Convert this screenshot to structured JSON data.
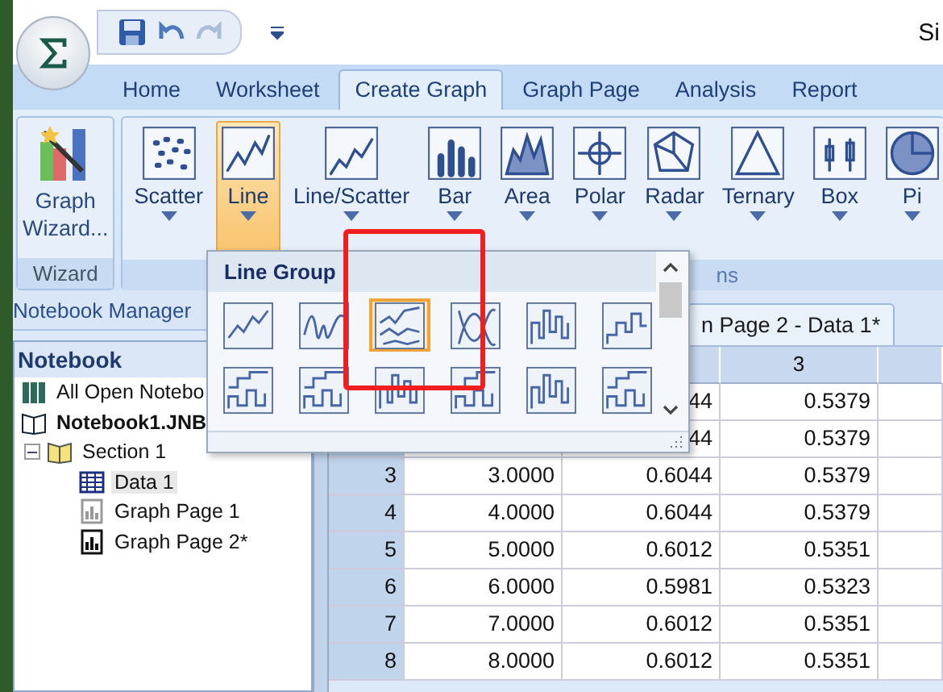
{
  "window": {
    "title": "Si"
  },
  "tabs": [
    {
      "label": "Home",
      "selected": false
    },
    {
      "label": "Worksheet",
      "selected": false
    },
    {
      "label": "Create Graph",
      "selected": true
    },
    {
      "label": "Graph Page",
      "selected": false
    },
    {
      "label": "Analysis",
      "selected": false
    },
    {
      "label": "Report",
      "selected": false
    }
  ],
  "ribbon": {
    "wizard": {
      "label": "Graph Wizard...",
      "group_label": "Wizard"
    },
    "buttons": [
      {
        "kind": "scatter",
        "label": "Scatter",
        "selected": false
      },
      {
        "kind": "line",
        "label": "Line",
        "selected": true
      },
      {
        "kind": "linescatter",
        "label": "Line/Scatter",
        "selected": false
      },
      {
        "kind": "bar",
        "label": "Bar",
        "selected": false
      },
      {
        "kind": "area",
        "label": "Area",
        "selected": false
      },
      {
        "kind": "polar",
        "label": "Polar",
        "selected": false
      },
      {
        "kind": "radar",
        "label": "Radar",
        "selected": false
      },
      {
        "kind": "ternary",
        "label": "Ternary",
        "selected": false
      },
      {
        "kind": "box",
        "label": "Box",
        "selected": false
      },
      {
        "kind": "pie",
        "label": "Pi",
        "selected": false
      }
    ],
    "group_label": "ns"
  },
  "gallery": {
    "title": "Line Group",
    "items": [
      {
        "kind": "straight",
        "selected": false
      },
      {
        "kind": "wavy",
        "selected": false
      },
      {
        "kind": "multi",
        "selected": true
      },
      {
        "kind": "spline",
        "selected": false
      },
      {
        "kind": "vstep",
        "selected": false
      },
      {
        "kind": "hstep",
        "selected": false
      },
      {
        "kind": "multi-hstep",
        "selected": false
      },
      {
        "kind": "multi-hstep",
        "selected": false
      },
      {
        "kind": "vstep",
        "selected": false
      },
      {
        "kind": "multi-hstep",
        "selected": false
      },
      {
        "kind": "vstep",
        "selected": false
      },
      {
        "kind": "multi-hstep",
        "selected": false
      }
    ]
  },
  "notebook_manager": {
    "title": "Notebook Manager",
    "panel_title": "Notebook",
    "tree": [
      {
        "kind": "all",
        "label": "All Open Notebo",
        "selected": false
      },
      {
        "kind": "notebook",
        "label": "Notebook1.JNB",
        "selected": false,
        "children": [
          {
            "kind": "section",
            "label": "Section 1",
            "selected": false,
            "expanded": true,
            "children": [
              {
                "kind": "worksheet",
                "label": "Data 1",
                "selected": true
              },
              {
                "kind": "graph-closed",
                "label": "Graph Page 1",
                "selected": false
              },
              {
                "kind": "graph",
                "label": "Graph Page 2*",
                "selected": false
              }
            ]
          }
        ]
      }
    ]
  },
  "sheet_tab": {
    "label": "n Page 2 - Data 1*"
  },
  "table": {
    "column_3": "3",
    "rows": [
      {
        "index": null,
        "cells": [
          null,
          "44",
          "0.5379"
        ]
      },
      {
        "index": null,
        "cells": [
          null,
          "44",
          "0.5379"
        ]
      },
      {
        "index": "3",
        "cells": [
          "3.0000",
          "0.6044",
          "0.5379"
        ]
      },
      {
        "index": "4",
        "cells": [
          "4.0000",
          "0.6044",
          "0.5379"
        ]
      },
      {
        "index": "5",
        "cells": [
          "5.0000",
          "0.6012",
          "0.5351"
        ]
      },
      {
        "index": "6",
        "cells": [
          "6.0000",
          "0.5981",
          "0.5323"
        ]
      },
      {
        "index": "7",
        "cells": [
          "7.0000",
          "0.6012",
          "0.5351"
        ]
      },
      {
        "index": "8",
        "cells": [
          "8.0000",
          "0.6012",
          "0.5351"
        ]
      }
    ]
  }
}
